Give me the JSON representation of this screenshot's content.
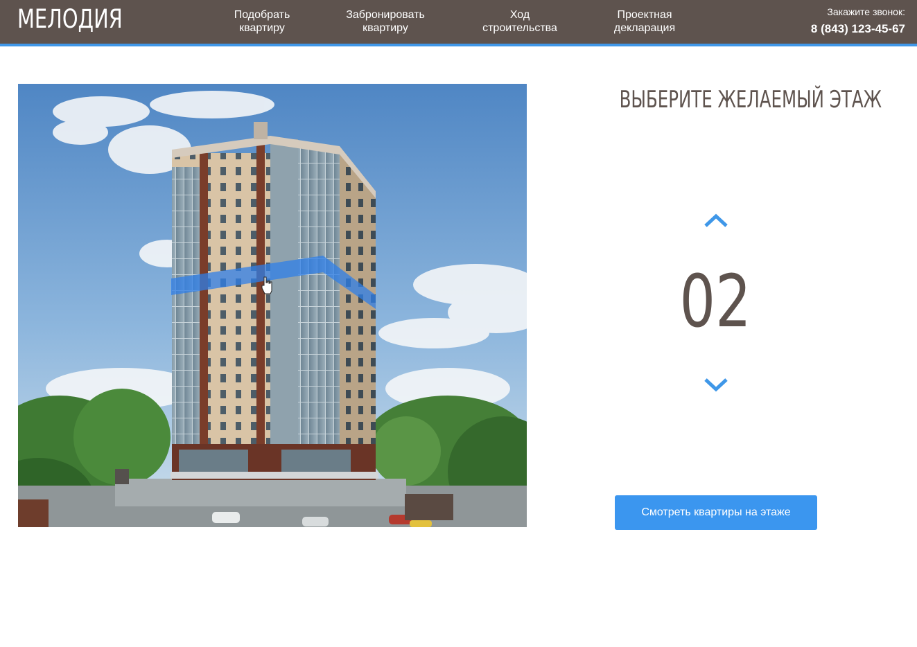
{
  "header": {
    "logo": "МЕЛОДИЯ",
    "nav": [
      {
        "line1": "Подобрать",
        "line2": "квартиру"
      },
      {
        "line1": "Забронировать",
        "line2": "квартиру"
      },
      {
        "line1": "Ход",
        "line2": "строительства"
      },
      {
        "line1": "Проектная",
        "line2": "декларация"
      }
    ],
    "callback_label": "Закажите звонок:",
    "phone": "8 (843) 123-45-67"
  },
  "floor_selector": {
    "title": "ВЫБЕРИТЕ ЖЕЛАЕМЫЙ ЭТАЖ",
    "current_floor": "02",
    "up_icon": "chevron-up-icon",
    "down_icon": "chevron-down-icon",
    "button_label": "Смотреть квартиры на этаже"
  },
  "colors": {
    "header_bg": "#5e534e",
    "accent": "#3f97e8",
    "button": "#3b96ef",
    "text_dark": "#5e534e"
  }
}
